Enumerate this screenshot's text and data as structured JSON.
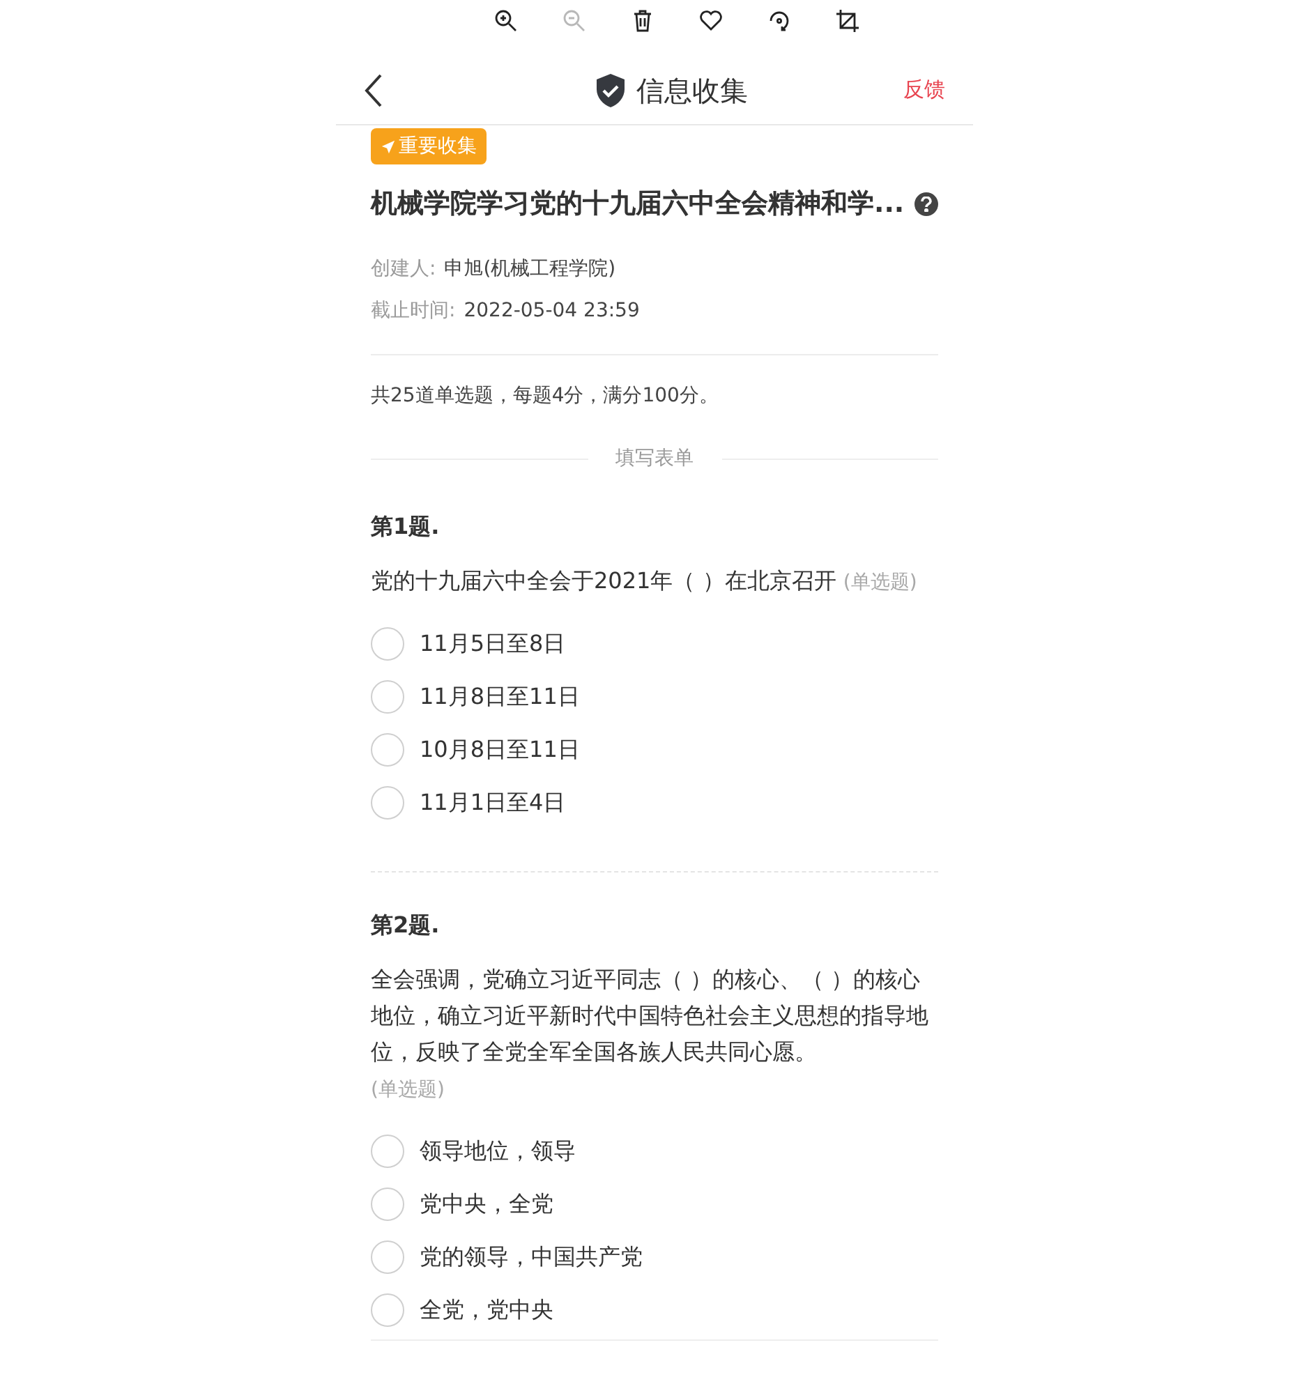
{
  "viewer_toolbar": {
    "zoom_out_disabled": true
  },
  "header": {
    "title": "信息收集",
    "feedback": "反馈"
  },
  "badge": "重要收集",
  "form": {
    "title": "机械学院学习党的十九届六中全会精神和学...",
    "meta": [
      {
        "label": "创建人:",
        "value": "申旭(机械工程学院)"
      },
      {
        "label": "截止时间:",
        "value": "2022-05-04 23:59"
      }
    ],
    "summary": "共25道单选题，每题4分，满分100分。",
    "section_label": "填写表单"
  },
  "questions": [
    {
      "number": "第1题.",
      "text": "党的十九届六中全会于2021年（ ）在北京召开",
      "type_note": "(单选题)",
      "options": [
        {
          "label": "11月5日至8日",
          "selected": false
        },
        {
          "label": "11月8日至11日",
          "selected": false
        },
        {
          "label": "10月8日至11日",
          "selected": false
        },
        {
          "label": "11月1日至4日",
          "selected": false
        }
      ]
    },
    {
      "number": "第2题.",
      "text": "全会强调，党确立习近平同志（ ）的核心、（ ）的核心地位，确立习近平新时代中国特色社会主义思想的指导地位，反映了全党全军全国各族人民共同心愿。",
      "type_note": "(单选题)",
      "options": [
        {
          "label": "领导地位，领导",
          "selected": false
        },
        {
          "label": "党中央，全党",
          "selected": false
        },
        {
          "label": "党的领导，中国共产党",
          "selected": false
        },
        {
          "label": "全党，党中央",
          "selected": false
        }
      ]
    }
  ]
}
